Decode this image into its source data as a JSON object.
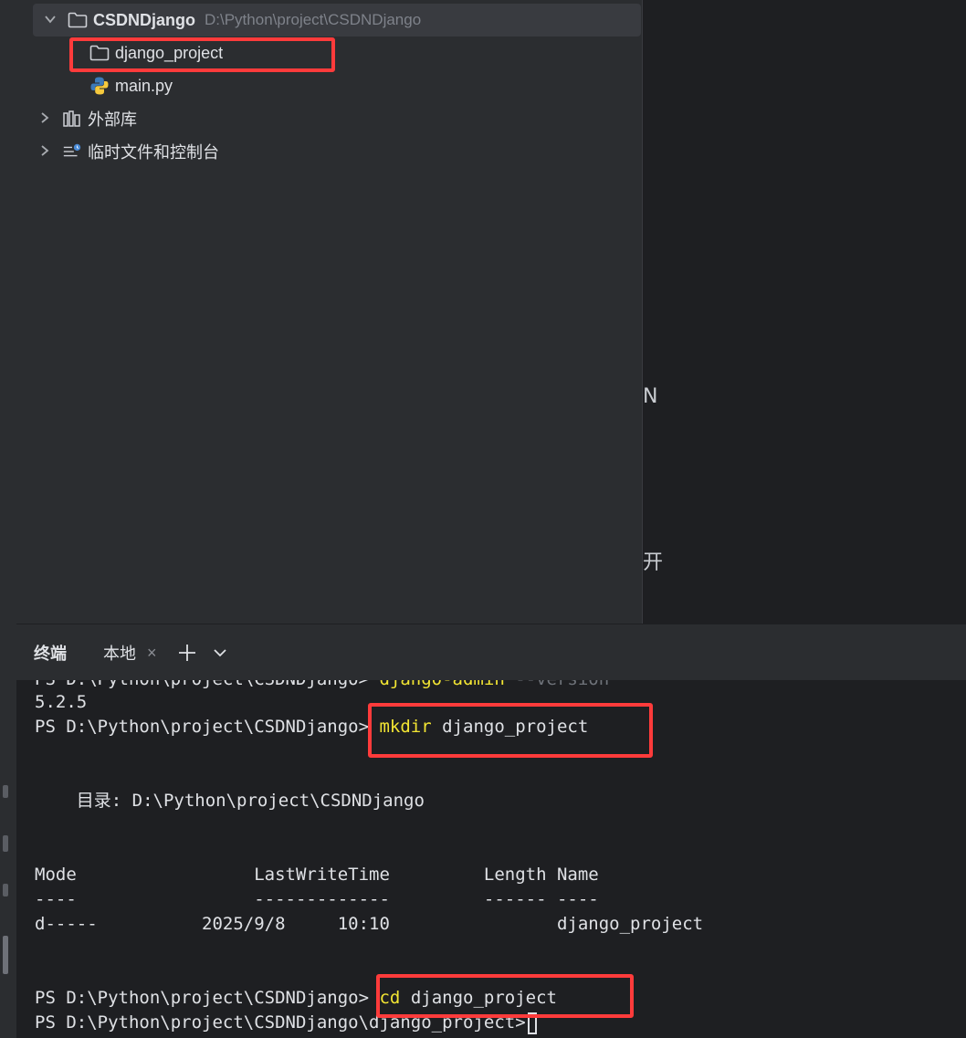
{
  "project_tree": {
    "root": {
      "name": "CSDNDjango",
      "path": "D:\\Python\\project\\CSDNDjango"
    },
    "children": [
      {
        "name": "django_project",
        "icon": "folder-icon"
      },
      {
        "name": "main.py",
        "icon": "python-file-icon"
      }
    ],
    "external_libraries": "外部库",
    "scratches": "临时文件和控制台"
  },
  "editor_fragments": {
    "char1": "N",
    "char2": "开"
  },
  "terminal": {
    "title": "终端",
    "tab_label": "本地",
    "tab_close": "×",
    "add_label": "+",
    "dropdown_label": "⌄",
    "lines": {
      "l0_prompt": "PS D:\\Python\\project\\CSDNDjango>",
      "l0_cmd": " django-admin",
      "l0_arg": " --version",
      "l1": "5.2.5",
      "l2_prompt": "PS D:\\Python\\project\\CSDNDjango>",
      "l2_cmd": " mkdir",
      "l2_arg": " django_project",
      "l3": "    目录: D:\\Python\\project\\CSDNDjango",
      "l4": "Mode                 LastWriteTime         Length Name",
      "l5": "----                 -------------         ------ ----",
      "l6": "d-----          2025/9/8     10:10                django_project",
      "l7_prompt": "PS D:\\Python\\project\\CSDNDjango>",
      "l7_cmd": " cd",
      "l7_arg": " django_project",
      "l8_prompt": "PS D:\\Python\\project\\CSDNDjango\\django_project>"
    }
  }
}
